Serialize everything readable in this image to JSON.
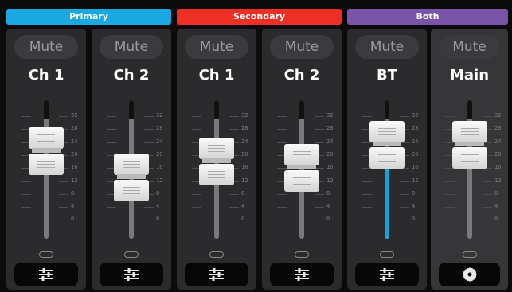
{
  "groups": [
    {
      "label": "Primary",
      "color": "#19a8e0"
    },
    {
      "label": "Secondary",
      "color": "#ee3024"
    },
    {
      "label": "Both",
      "color": "#7a54a8"
    }
  ],
  "scale_labels": [
    "32",
    "28",
    "24",
    "20",
    "16",
    "12",
    "8",
    "4",
    "0"
  ],
  "channels": [
    {
      "mute": "Mute",
      "name": "Ch 1",
      "level": 28,
      "button_icon": "sliders-icon"
    },
    {
      "mute": "Mute",
      "name": "Ch 2",
      "level": 20,
      "button_icon": "sliders-icon"
    },
    {
      "mute": "Mute",
      "name": "Ch 1",
      "level": 25,
      "button_icon": "sliders-icon"
    },
    {
      "mute": "Mute",
      "name": "Ch 2",
      "level": 23,
      "button_icon": "sliders-icon"
    },
    {
      "mute": "Mute",
      "name": "BT",
      "level": 30,
      "button_icon": "sliders-icon",
      "meter_level": 18
    },
    {
      "mute": "Mute",
      "name": "Main",
      "level": 30,
      "button_icon": "gear-icon"
    }
  ]
}
